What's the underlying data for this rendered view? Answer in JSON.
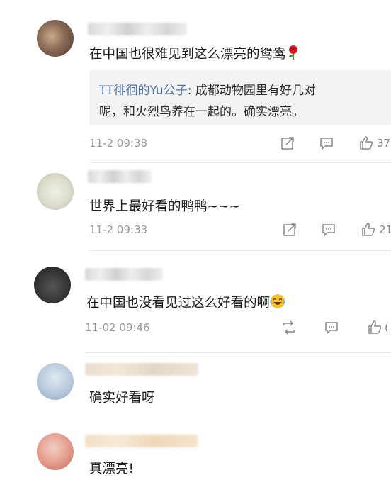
{
  "comments": [
    {
      "text": "在中国也很难见到这么漂亮的鸳鸯",
      "reply": {
        "user": "TT徘徊的Yu公子",
        "sep": ": ",
        "line1_rest": "成都动物园里有好几对",
        "line2": "呢，和火烈鸟养在一起的。确实漂亮。"
      },
      "time": "11-2 09:38",
      "likes": "37"
    },
    {
      "text": "世界上最好看的鸭鸭~~~",
      "time": "11-2 09:33",
      "likes": "21"
    },
    {
      "text": "在中国也没看见过这么好看的啊",
      "time": "11-02 09:46",
      "likes": "("
    },
    {
      "text": "确实好看呀"
    },
    {
      "text": "真漂亮!"
    }
  ],
  "icons": {
    "share": "share-icon",
    "comment": "comment-icon",
    "like": "thumbs-up-icon",
    "repost": "repost-icon",
    "rose": "rose-emoji-icon",
    "laugh": "laugh-crying-emoji-icon"
  },
  "colors": {
    "reply_user": "#4f74a8",
    "time": "#9a9a9a",
    "reply_bg": "#f3f3f3"
  }
}
